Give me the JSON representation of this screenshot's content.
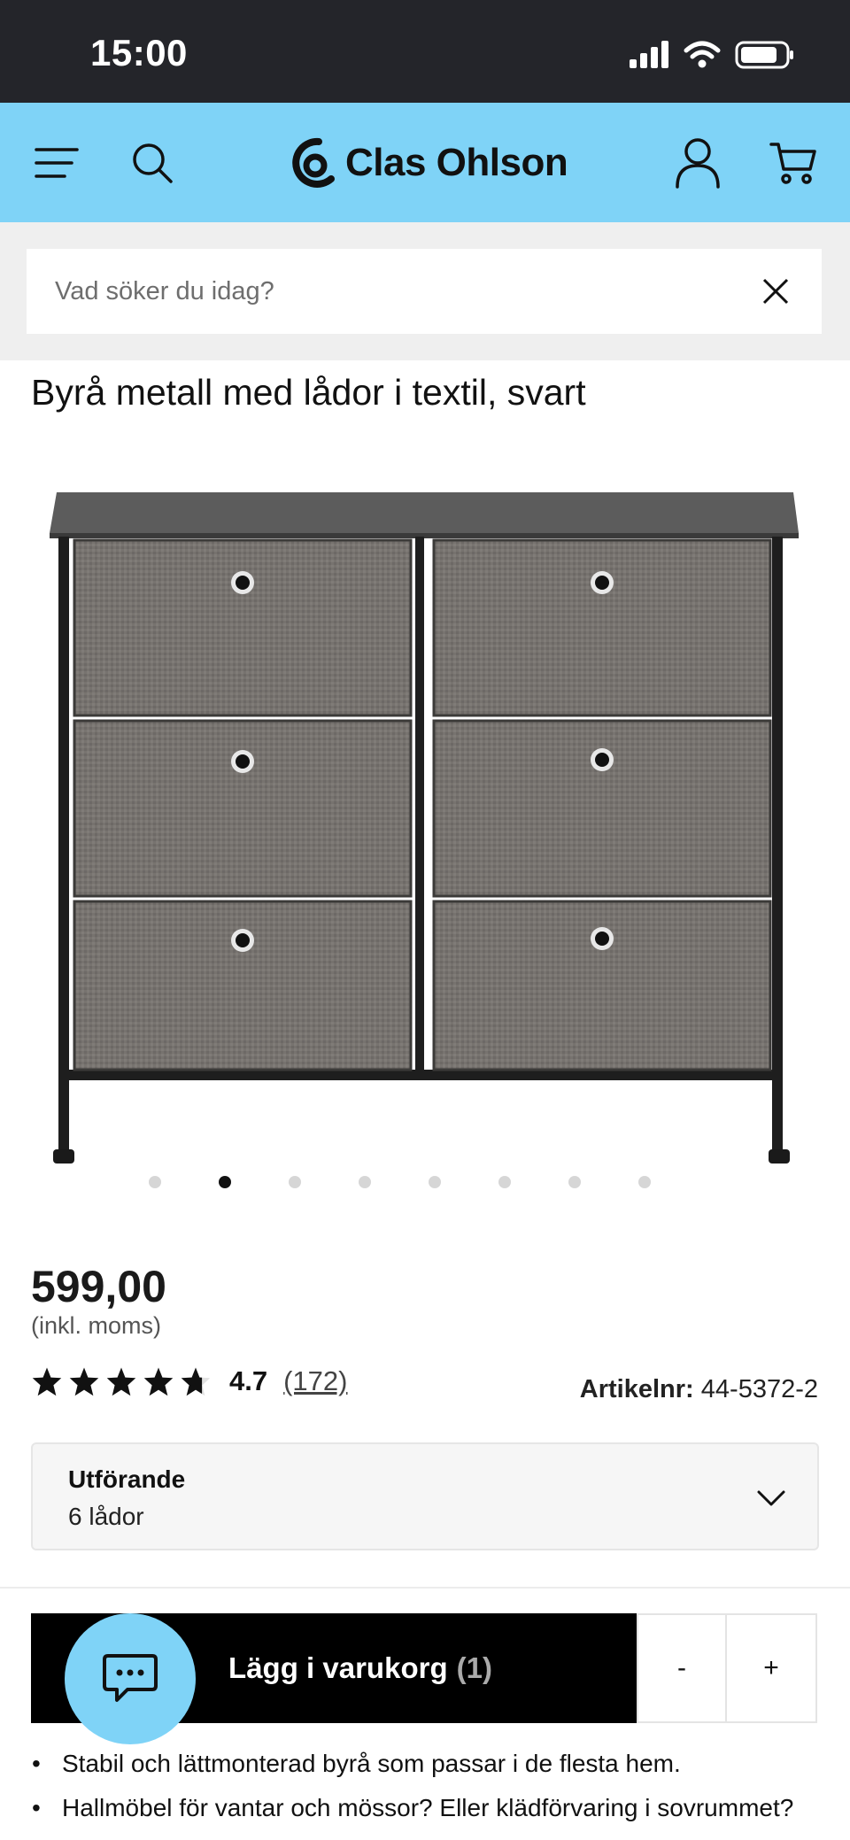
{
  "status_bar": {
    "time": "15:00"
  },
  "header": {
    "logo_text": "Clas Ohlson",
    "accent_color": "#7fd3f7",
    "icons": [
      "menu-icon",
      "search-icon",
      "account-icon",
      "cart-icon"
    ]
  },
  "search": {
    "placeholder": "Vad söker du idag?"
  },
  "product": {
    "title": "Byrå metall med lådor i textil, svart",
    "price": "599,00",
    "price_note": "(inkl. moms)",
    "rating_value": "4.7",
    "rating_count": "(172)",
    "rating_stars": 4.7,
    "article_label": "Artikelnr:",
    "article_number": "44-5372-2",
    "image_dots_total": 8,
    "image_dots_active": 2
  },
  "variant": {
    "label": "Utförande",
    "value": "6 lådor"
  },
  "cart": {
    "label": "Lägg i varukorg",
    "count": "(1)",
    "minus": "-",
    "plus": "+"
  },
  "bullets": [
    "Stabil och lättmonterad byrå som passar i de flesta hem.",
    "Hallmöbel för vantar och mössor? Eller klädförvaring i sovrummet?"
  ]
}
